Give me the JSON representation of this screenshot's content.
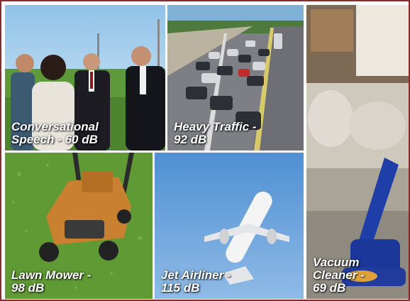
{
  "tiles": [
    {
      "line1": "Conversational",
      "line2": "Speech - 60 dB",
      "icon": "people-talking-image"
    },
    {
      "line1": "Heavy Traffic -",
      "line2": "92 dB",
      "icon": "highway-traffic-image"
    },
    {
      "line1": "Vacuum",
      "line2": "Cleaner -",
      "line3": "69 dB",
      "icon": "vacuum-cleaner-image"
    },
    {
      "line1": "Lawn Mower -",
      "line2": "98 dB",
      "icon": "lawn-mower-image"
    },
    {
      "line1": "Jet Airliner -",
      "line2": "115 dB",
      "icon": "jet-airliner-image"
    }
  ],
  "colors": {
    "border": "#8b2a2a",
    "caption": "#ffffff"
  }
}
